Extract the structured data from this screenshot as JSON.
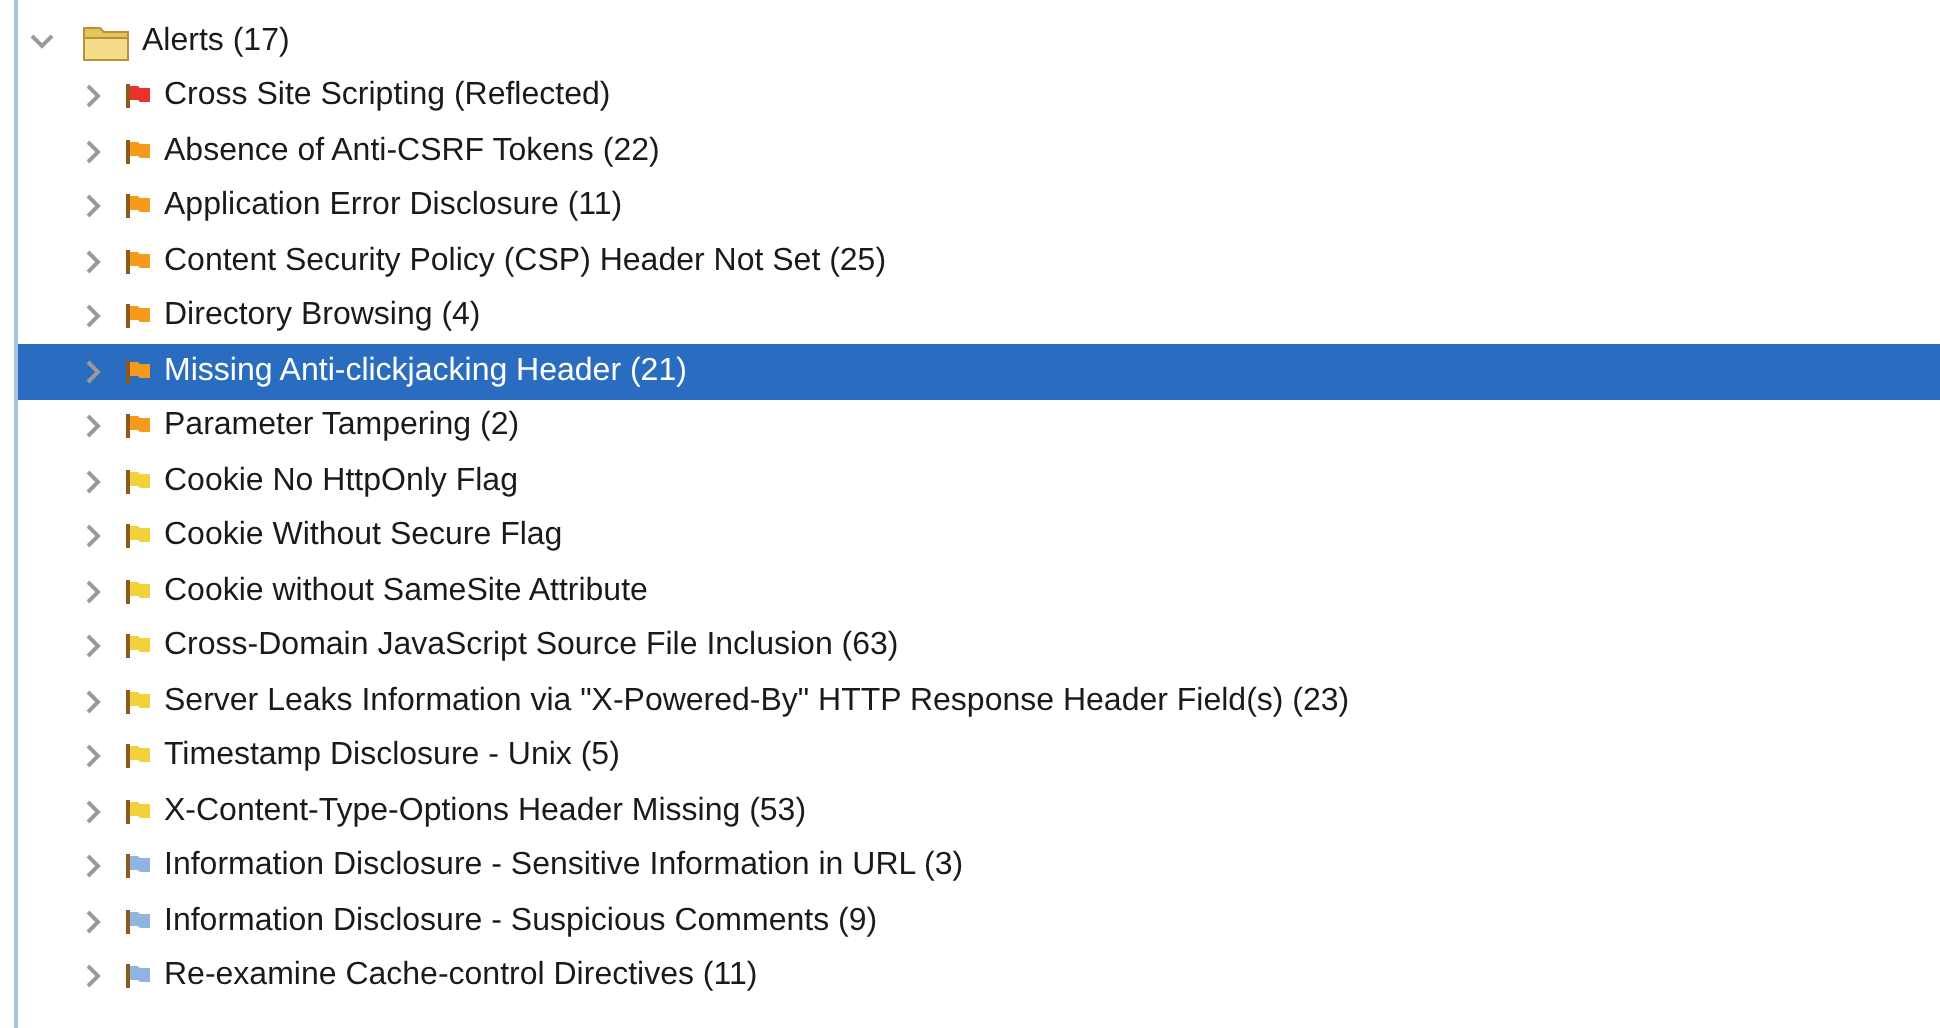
{
  "tree": {
    "label": "Alerts (17)",
    "expanded": true,
    "children": [
      {
        "label": "Cross Site Scripting (Reflected)",
        "color": "#e8332a",
        "expanded": false,
        "selected": false
      },
      {
        "label": "Absence of Anti-CSRF Tokens (22)",
        "color": "#f59a1b",
        "expanded": false,
        "selected": false
      },
      {
        "label": "Application Error Disclosure (11)",
        "color": "#f59a1b",
        "expanded": false,
        "selected": false
      },
      {
        "label": "Content Security Policy (CSP) Header Not Set (25)",
        "color": "#f59a1b",
        "expanded": false,
        "selected": false
      },
      {
        "label": "Directory Browsing (4)",
        "color": "#f59a1b",
        "expanded": false,
        "selected": false
      },
      {
        "label": "Missing Anti-clickjacking Header (21)",
        "color": "#f59a1b",
        "expanded": false,
        "selected": true
      },
      {
        "label": "Parameter Tampering (2)",
        "color": "#f59a1b",
        "expanded": false,
        "selected": false
      },
      {
        "label": "Cookie No HttpOnly Flag",
        "color": "#f2d23a",
        "expanded": false,
        "selected": false
      },
      {
        "label": "Cookie Without Secure Flag",
        "color": "#f2d23a",
        "expanded": false,
        "selected": false
      },
      {
        "label": "Cookie without SameSite Attribute",
        "color": "#f2d23a",
        "expanded": false,
        "selected": false
      },
      {
        "label": "Cross-Domain JavaScript Source File Inclusion (63)",
        "color": "#f2d23a",
        "expanded": false,
        "selected": false
      },
      {
        "label": "Server Leaks Information via \"X-Powered-By\" HTTP Response Header Field(s) (23)",
        "color": "#f2d23a",
        "expanded": false,
        "selected": false
      },
      {
        "label": "Timestamp Disclosure - Unix (5)",
        "color": "#f2d23a",
        "expanded": false,
        "selected": false
      },
      {
        "label": "X-Content-Type-Options Header Missing (53)",
        "color": "#f2d23a",
        "expanded": false,
        "selected": false
      },
      {
        "label": "Information Disclosure - Sensitive Information in URL (3)",
        "color": "#8fb4de",
        "expanded": false,
        "selected": false
      },
      {
        "label": "Information Disclosure - Suspicious Comments (9)",
        "color": "#8fb4de",
        "expanded": false,
        "selected": false
      },
      {
        "label": "Re-examine Cache-control Directives (11)",
        "color": "#8fb4de",
        "expanded": false,
        "selected": false
      }
    ]
  }
}
